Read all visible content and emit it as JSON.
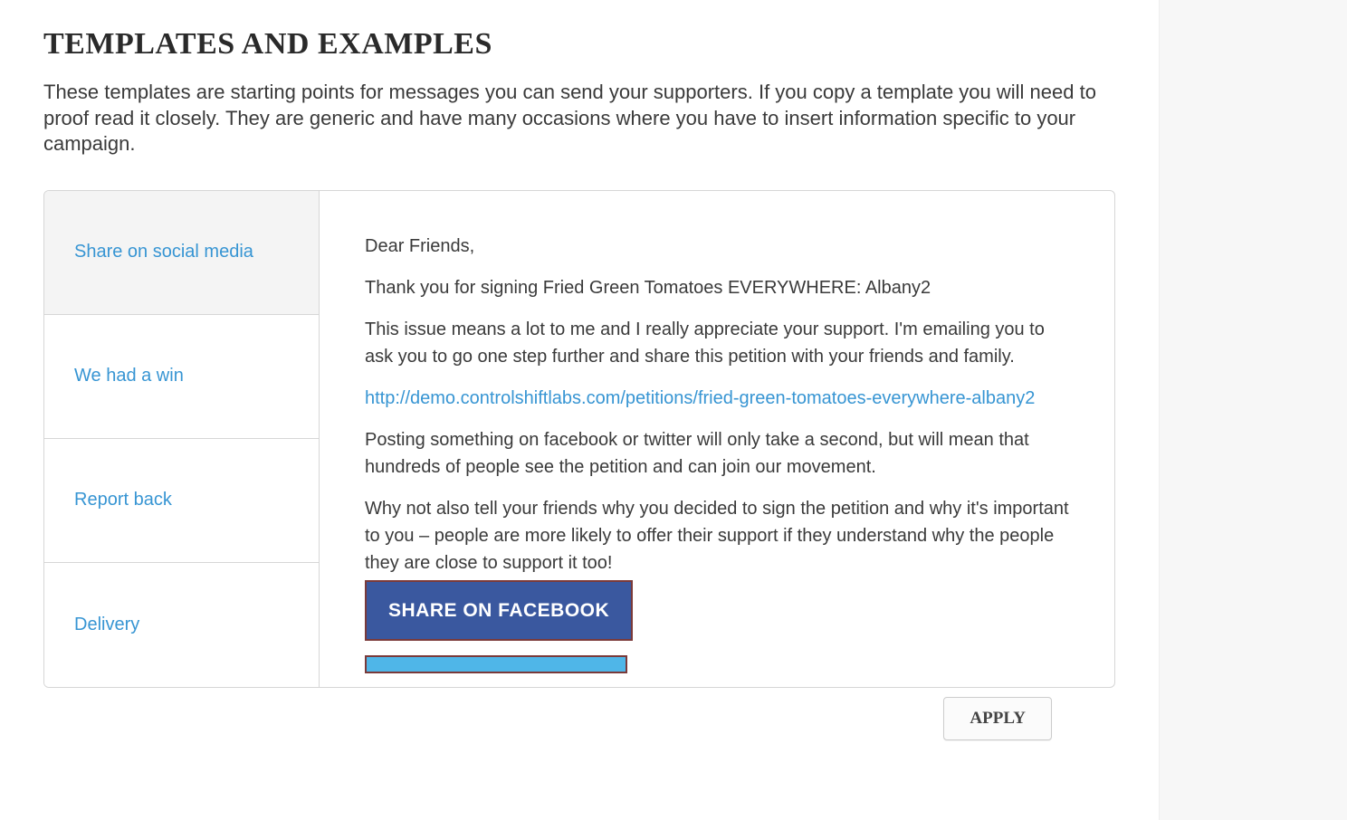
{
  "header": {
    "title": "TEMPLATES AND EXAMPLES",
    "intro": "These templates are starting points for messages you can send your supporters. If you copy a template you will need to proof read it closely. They are generic and have many occasions where you have to insert information specific to your campaign."
  },
  "tabs": [
    {
      "label": "Share on social media",
      "active": true
    },
    {
      "label": "We had a win",
      "active": false
    },
    {
      "label": "Report back",
      "active": false
    },
    {
      "label": "Delivery",
      "active": false
    }
  ],
  "template_content": {
    "p1": "Dear Friends,",
    "p2": "Thank you for signing Fried Green Tomatoes EVERYWHERE: Albany2",
    "p3": "This issue means a lot to me and I really appreciate your support. I'm emailing you to ask you to go one step further and share this petition with your friends and family.",
    "link": "http://demo.controlshiftlabs.com/petitions/fried-green-tomatoes-everywhere-albany2",
    "p4": "Posting something on facebook or twitter will only take a second, but will mean that hundreds of people see the petition and can join our movement.",
    "p5": "Why not also tell your friends why you decided to sign the petition and why it's important to you – people are more likely to offer their support if they understand why the people they are close to support it too!",
    "share_facebook": "SHARE ON FACEBOOK"
  },
  "actions": {
    "apply": "APPLY"
  }
}
